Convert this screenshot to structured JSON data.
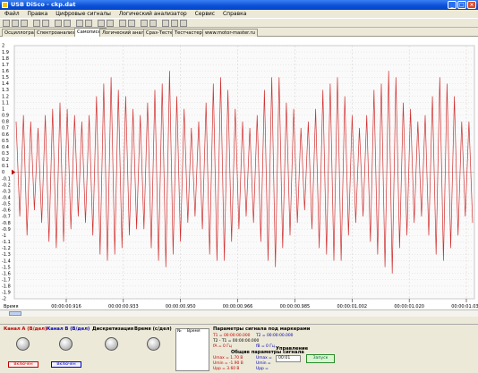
{
  "window": {
    "title": "USB DiSco - ckp.dat"
  },
  "menu": [
    "Файл",
    "Правка",
    "Цифровые сигналы",
    "Логический анализатор",
    "Сервис",
    "Справка"
  ],
  "tabs": [
    "Осциллограф",
    "Спектроанализатор",
    "Самописец",
    "Логический анализатор",
    "Сраз-Тестер",
    "Тестчастер",
    "www.motor-master.ru"
  ],
  "active_tab": 2,
  "y_axis": {
    "labels": [
      "2",
      "1.9",
      "1.8",
      "1.7",
      "1.6",
      "1.5",
      "1.4",
      "1.3",
      "1.2",
      "1.1",
      "1",
      "0.9",
      "0.8",
      "0.7",
      "0.6",
      "0.5",
      "0.4",
      "0.3",
      "0.2",
      "0.1",
      "0",
      "-0.1",
      "-0.2",
      "-0.3",
      "-0.4",
      "-0.5",
      "-0.6",
      "-0.7",
      "-0.8",
      "-0.9",
      "-1",
      "-1.1",
      "-1.2",
      "-1.3",
      "-1.4",
      "-1.5",
      "-1.6",
      "-1.7",
      "-1.8",
      "-1.9",
      "-2"
    ],
    "unit_label": "Вольт"
  },
  "x_axis": {
    "time_label": "Время",
    "ticks": [
      "00:00:00.916",
      "00:00:00.933",
      "00:00:00.950",
      "00:00:00.966",
      "00:00:00.985",
      "00:00:01.002",
      "00:00:01.020",
      "00:00:01.037"
    ]
  },
  "chart_data": {
    "type": "line",
    "ylim": [
      -2,
      2
    ],
    "x": [
      "00:00:00.916",
      "00:00:00.933",
      "00:00:00.950",
      "00:00:00.966",
      "00:00:00.985",
      "00:00:01.002",
      "00:00:01.020",
      "00:00:01.037"
    ],
    "series": [
      {
        "color": "#d23030",
        "values": [
          0.8,
          -0.7,
          0.9,
          -1.0,
          0.8,
          -0.6,
          0.7,
          -0.8,
          0.9,
          -1.1,
          1.0,
          -1.2,
          1.1,
          -1.1,
          1.0,
          -0.9,
          0.9,
          -0.7,
          0.8,
          -0.8,
          0.9,
          -1.0,
          1.2,
          -1.3,
          1.4,
          -1.4,
          1.5,
          -1.3,
          1.3,
          -1.2,
          1.2,
          -1.0,
          1.0,
          -0.9,
          0.9,
          -0.9,
          1.1,
          -1.2,
          1.3,
          -1.4,
          1.4,
          -1.5,
          1.6,
          -1.3,
          1.2,
          -1.1,
          1.0,
          -0.8,
          0.7,
          -0.7,
          0.8,
          -0.9,
          1.1,
          -1.3,
          1.4,
          -1.4,
          1.5,
          -1.4,
          1.3,
          -1.1,
          1.0,
          -0.9,
          0.8,
          -0.7,
          0.7,
          -0.8,
          0.9,
          -1.1,
          1.3,
          -1.4,
          1.5,
          -1.5,
          1.5,
          -1.2,
          1.1,
          -1.0,
          1.0,
          -0.8,
          0.7,
          -0.6,
          0.8,
          -0.9,
          1.0,
          -1.2,
          1.3,
          -1.3,
          1.4,
          -1.4,
          1.5,
          -1.4,
          1.2,
          -1.0,
          0.9,
          -0.8,
          0.7,
          -0.7,
          0.9,
          -1.1,
          1.3,
          -1.3,
          1.4,
          -1.5,
          1.6,
          -1.6,
          1.5,
          -1.2,
          1.1,
          -1.0,
          1.0,
          -0.8,
          0.8,
          -0.7,
          0.9,
          -1.0,
          1.2,
          -1.3,
          1.5,
          -1.4,
          1.4,
          -1.2,
          1.2,
          -1.0,
          0.8,
          -0.7,
          0.8,
          -0.8
        ]
      }
    ]
  },
  "bottom": {
    "channel_a": {
      "title": "Канал A (В/дел)",
      "on_label": "Включен",
      "color": "#c00000"
    },
    "channel_b": {
      "title": "Канал B (В/дел)",
      "on_label": "Включен",
      "color": "#0000b0"
    },
    "sampling": {
      "title": "Дискретизация"
    },
    "time": {
      "title": "Время (с/дел)"
    },
    "table": {
      "col_n": "№",
      "col_time": "Время"
    },
    "markers": {
      "title": "Параметры сигнала под маркерами",
      "t1": "T1 = 00:00:00.000",
      "t2": "T2 = 00:00:00.000",
      "dt": "T2 - T1 = 00:00:00.000",
      "fa": "fA = 0 Гц",
      "fb": "fB = 0 Гц"
    },
    "general": {
      "title": "Общие параметры сигнала",
      "umax_a": "Umax = 1.70 В",
      "umin_a": "Umin = -1.90 В",
      "upp_a": "Upp = 3.60 В",
      "umax_b": "Umax =",
      "umin_b": "Umin =",
      "upp_b": "Upp ="
    },
    "control": {
      "title": "Управление",
      "time_value": "00:01",
      "start_label": "Запуск"
    }
  }
}
